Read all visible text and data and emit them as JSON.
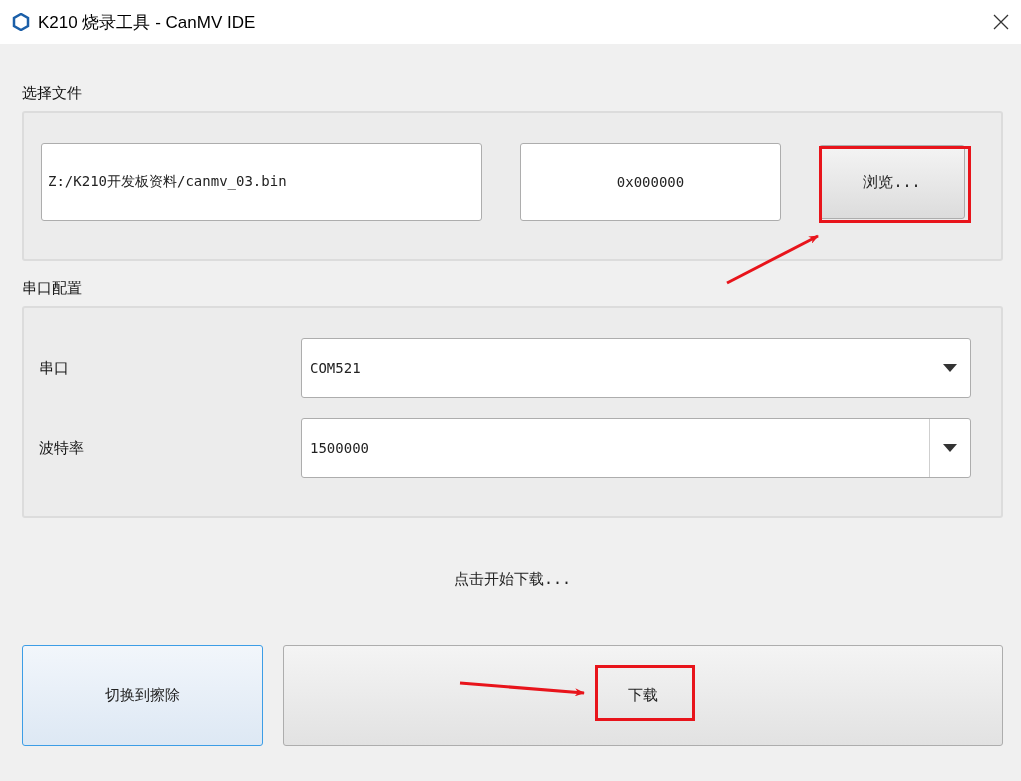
{
  "window": {
    "title": "K210 烧录工具 - CanMV IDE"
  },
  "file_section": {
    "label": "选择文件",
    "path": "Z:/K210开发板资料/canmv_03.bin",
    "address": "0x000000",
    "browse_button": "浏览..."
  },
  "serial_section": {
    "label": "串口配置",
    "rows": [
      {
        "label": "串口",
        "value": "COM521",
        "kind": "dropdown"
      },
      {
        "label": "波特率",
        "value": "1500000",
        "kind": "editable"
      }
    ]
  },
  "status": "点击开始下载...",
  "buttons": [
    {
      "label": "切换到擦除",
      "focused": true
    },
    {
      "label": "下载",
      "focused": false
    }
  ]
}
